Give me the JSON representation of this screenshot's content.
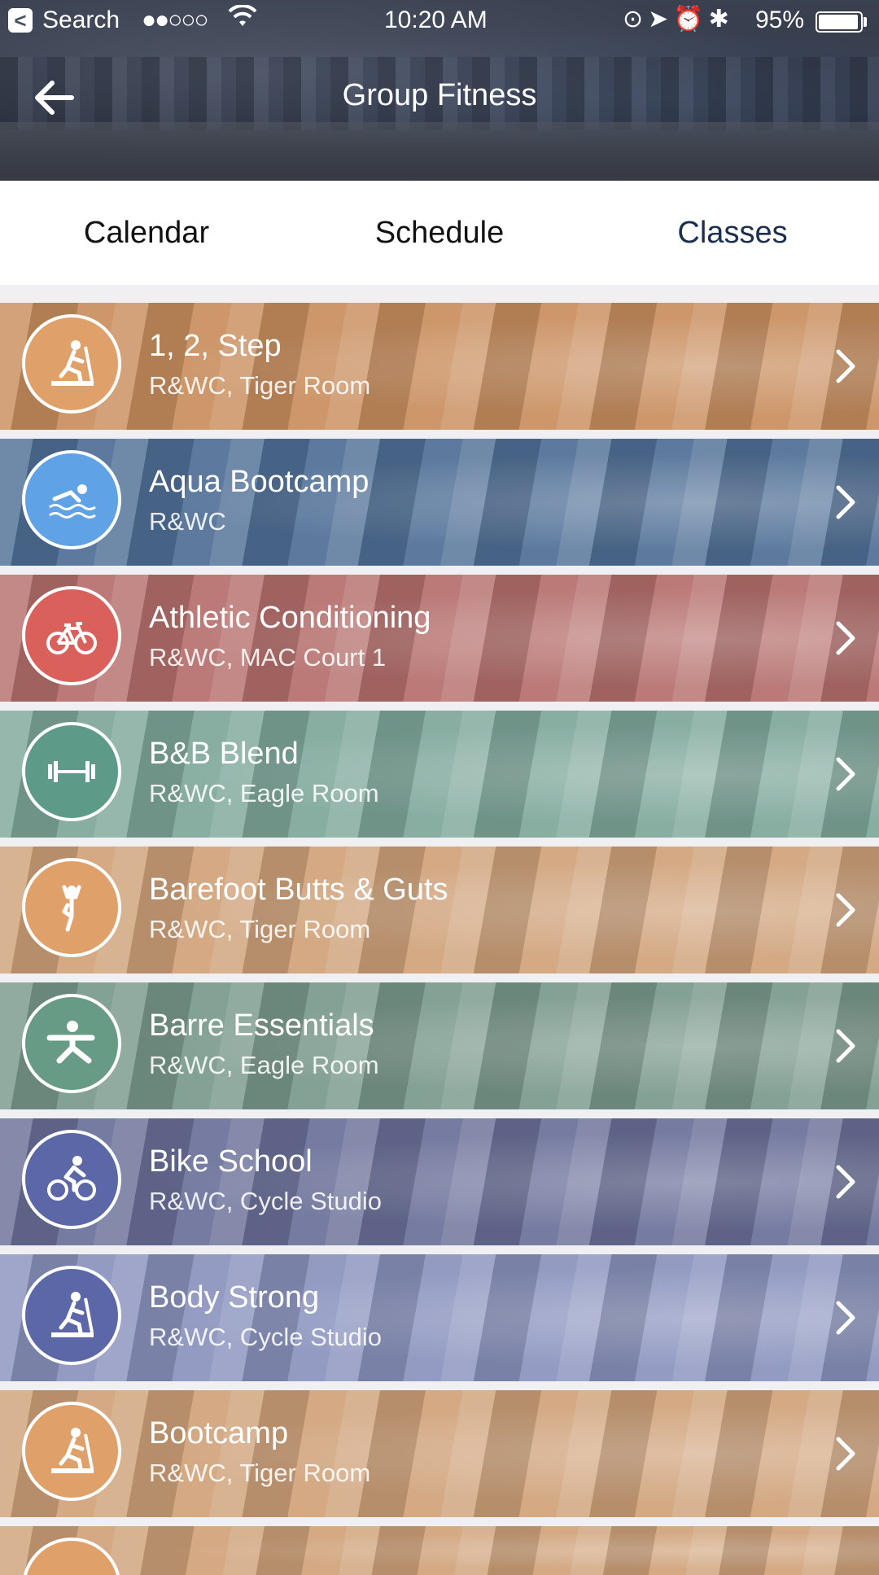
{
  "status_bar": {
    "back_app_glyph": "<",
    "carrier": "Search",
    "signal": "●●○○○",
    "time": "10:20 AM",
    "battery_text": "95%",
    "battery_level": 0.95
  },
  "nav": {
    "title": "Group Fitness",
    "back_icon": "arrow-left-icon"
  },
  "tabs": [
    {
      "label": "Calendar",
      "active": false
    },
    {
      "label": "Schedule",
      "active": false
    },
    {
      "label": "Classes",
      "active": true
    }
  ],
  "classes": [
    {
      "title": "1, 2, Step",
      "location": "R&WC, Tiger Room",
      "icon": "step-icon",
      "color": "#e0a06a",
      "tint": "#c98e5e"
    },
    {
      "title": "Aqua Bootcamp",
      "location": "R&WC",
      "icon": "swimmer-icon",
      "color": "#5fa2e6",
      "tint": "#4f6f96"
    },
    {
      "title": "Athletic Conditioning",
      "location": "R&WC, MAC Court 1",
      "icon": "bicycle-icon",
      "color": "#d9605b",
      "tint": "#b56f6c"
    },
    {
      "title": "B&B Blend",
      "location": "R&WC, Eagle Room",
      "icon": "barbell-icon",
      "color": "#5e9a88",
      "tint": "#7ea79a"
    },
    {
      "title": "Barefoot Butts & Guts",
      "location": "R&WC, Tiger Room",
      "icon": "yoga-icon",
      "color": "#e0a06a",
      "tint": "#d0a27a"
    },
    {
      "title": "Barre Essentials",
      "location": "R&WC, Eagle Room",
      "icon": "stretch-icon",
      "color": "#679b85",
      "tint": "#7a998c"
    },
    {
      "title": "Bike School",
      "location": "R&WC, Cycle Studio",
      "icon": "cyclist-icon",
      "color": "#5b67a6",
      "tint": "#6a7099"
    },
    {
      "title": "Body Strong",
      "location": "R&WC, Cycle Studio",
      "icon": "step-icon",
      "color": "#5b67a6",
      "tint": "#8a93be"
    },
    {
      "title": "Bootcamp",
      "location": "R&WC, Tiger Room",
      "icon": "step-icon",
      "color": "#e0a06a",
      "tint": "#d0a27a"
    }
  ]
}
